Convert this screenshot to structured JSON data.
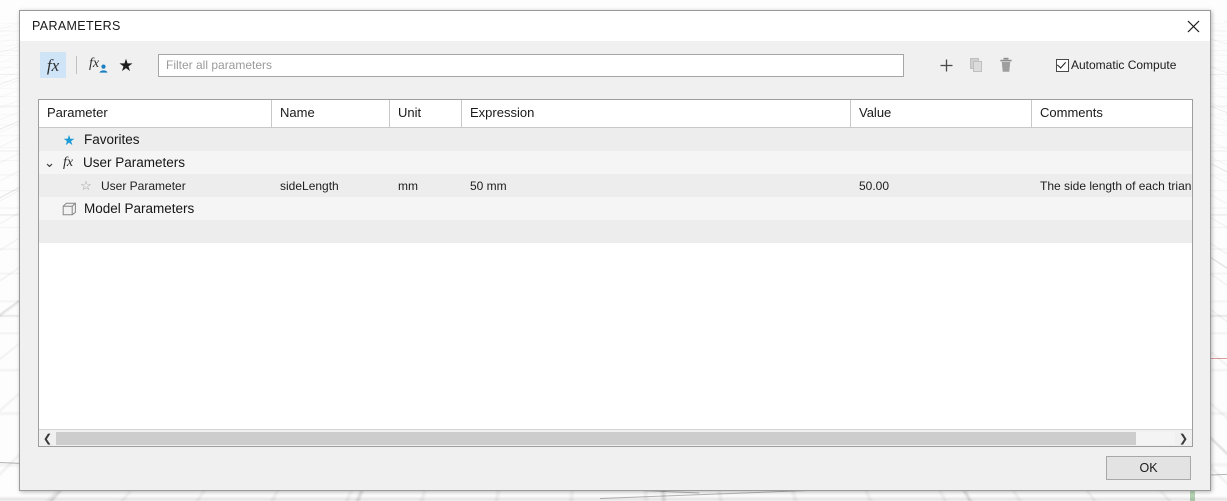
{
  "dialog": {
    "title": "PARAMETERS",
    "close_icon": "close-icon"
  },
  "toolbar": {
    "fx_all_label": "fx",
    "fx_user_label": "fx",
    "favorites_star_glyph": "★",
    "add_glyph": "+",
    "automatic_compute_label": "Automatic Compute"
  },
  "search": {
    "value": "",
    "placeholder": "Filter all parameters"
  },
  "table": {
    "columns": [
      "Parameter",
      "Name",
      "Unit",
      "Expression",
      "Value",
      "Comments"
    ],
    "rows": [
      {
        "icon": "star-filled-icon",
        "twisty": "",
        "indent": 1,
        "parameter": "Favorites",
        "name": "",
        "unit": "",
        "expression": "",
        "value": "",
        "comments": ""
      },
      {
        "icon": "fx-icon",
        "twisty": "⌄",
        "indent": 0,
        "parameter": "User Parameters",
        "name": "",
        "unit": "",
        "expression": "",
        "value": "",
        "comments": ""
      },
      {
        "icon": "star-outline-icon",
        "twisty": "",
        "indent": 2,
        "parameter": "User Parameter",
        "name": "sideLength",
        "unit": "mm",
        "expression": "50 mm",
        "value": "50.00",
        "comments": "The side length of each trian"
      },
      {
        "icon": "cube-icon",
        "twisty": "",
        "indent": 1,
        "parameter": "Model Parameters",
        "name": "",
        "unit": "",
        "expression": "",
        "value": "",
        "comments": ""
      }
    ]
  },
  "footer": {
    "ok_label": "OK"
  },
  "scrollbar": {
    "left_arrow": "❮",
    "right_arrow": "❯"
  }
}
